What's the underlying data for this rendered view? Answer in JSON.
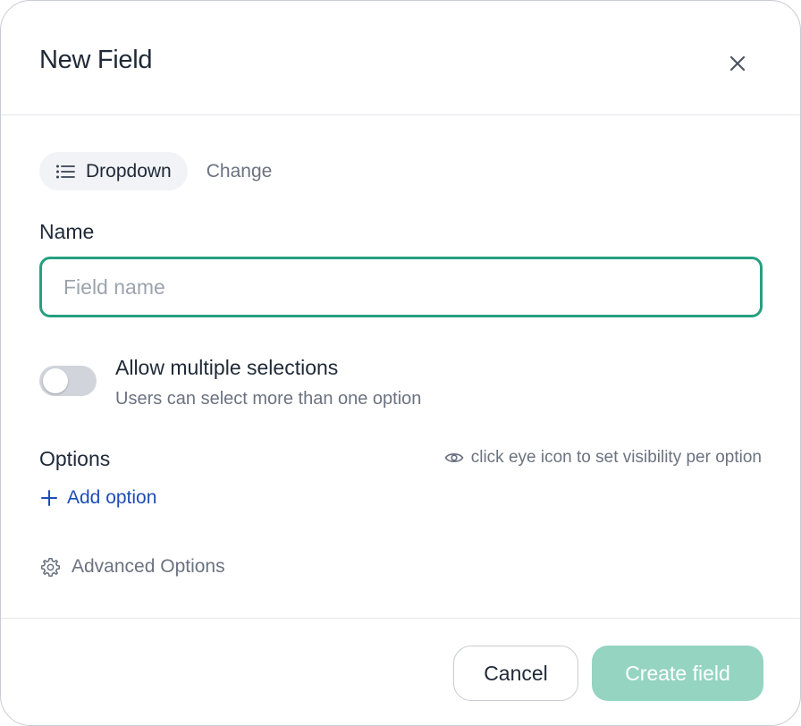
{
  "modal": {
    "title": "New Field",
    "close_icon": "close-icon"
  },
  "field_type": {
    "icon": "list-icon",
    "label": "Dropdown",
    "change_label": "Change"
  },
  "name": {
    "label": "Name",
    "value": "",
    "placeholder": "Field name"
  },
  "multiple": {
    "title": "Allow multiple selections",
    "description": "Users can select more than one option",
    "enabled": false
  },
  "options": {
    "label": "Options",
    "hint_icon": "eye-icon",
    "hint": "click eye icon to set visibility per option",
    "add_icon": "plus-icon",
    "add_label": "Add option"
  },
  "advanced": {
    "icon": "gear-icon",
    "label": "Advanced Options"
  },
  "footer": {
    "cancel_label": "Cancel",
    "create_label": "Create field"
  },
  "colors": {
    "accent": "#25a07f",
    "primary_disabled": "#95d4c1",
    "link": "#1e4db7"
  }
}
